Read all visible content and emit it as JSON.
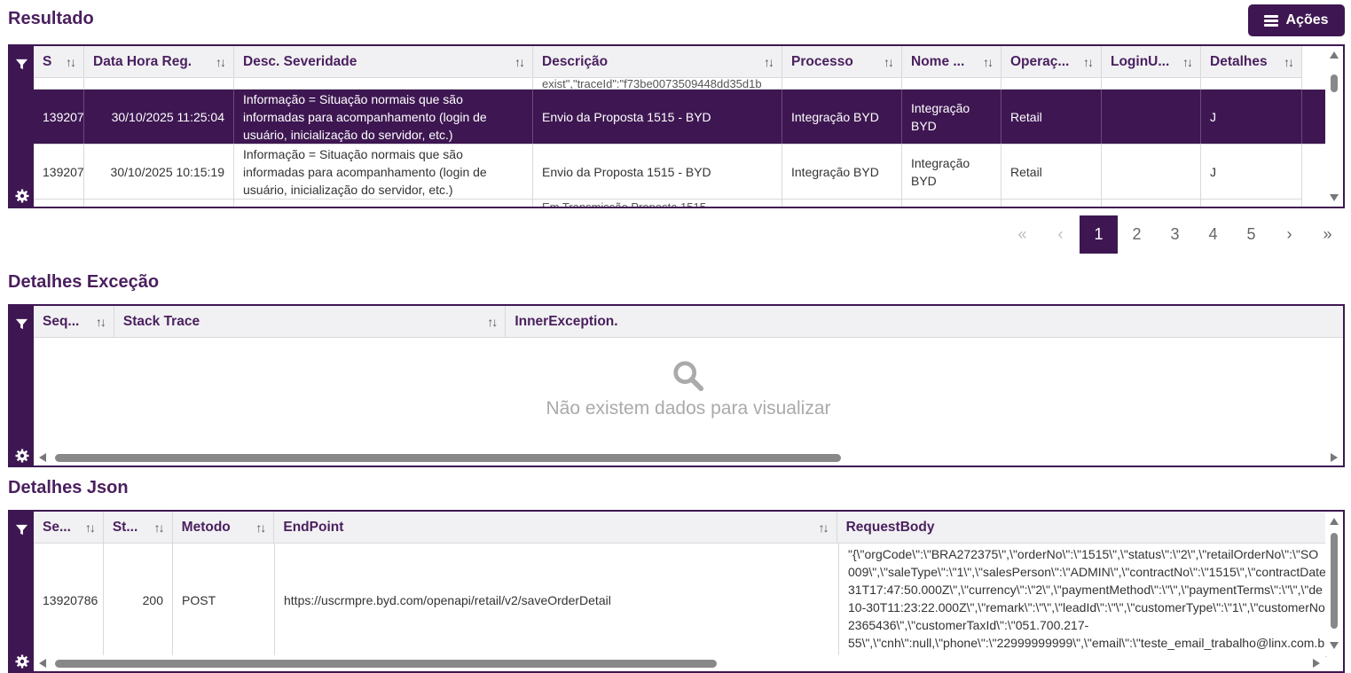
{
  "resultado": {
    "title": "Resultado",
    "acoes_label": "Ações",
    "headers": [
      "S",
      "Data Hora Reg.",
      "Desc. Severidade",
      "Descrição",
      "Processo",
      "Nome ...",
      "Operaç...",
      "LoginU...",
      "Detalhes"
    ],
    "partial_top_desc": "exist\",\"traceId\":\"f73be0073509448dd35d1b",
    "rows": [
      {
        "seq": "139207",
        "datetime": "30/10/2025 11:25:04",
        "severity": "Informação = Situação normais que são informadas para acompanhamento (login de usuário, inicialização do servidor, etc.)",
        "desc": "Envio da Proposta 1515 - BYD",
        "processo": "Integração BYD",
        "nome": "Integração BYD",
        "operacao": "Retail",
        "login": "",
        "detalhes": "J"
      },
      {
        "seq": "139207",
        "datetime": "30/10/2025 10:15:19",
        "severity": "Informação = Situação normais que são informadas para acompanhamento (login de usuário, inicialização do servidor, etc.)",
        "desc": "Envio da Proposta 1515 - BYD",
        "processo": "Integração BYD",
        "nome": "Integração BYD",
        "operacao": "Retail",
        "login": "",
        "detalhes": "J"
      }
    ],
    "partial_bottom_desc": "Em Transmissão Proposta 1515"
  },
  "pagination": {
    "first": "«",
    "prev": "‹",
    "pages": [
      "1",
      "2",
      "3",
      "4",
      "5"
    ],
    "active": "1",
    "next": "›",
    "last": "»"
  },
  "excecao": {
    "title": "Detalhes Exceção",
    "headers": [
      "Seq...",
      "Stack Trace",
      "InnerException."
    ],
    "empty_message": "Não existem dados para visualizar"
  },
  "json": {
    "title": "Detalhes Json",
    "headers": [
      "Se...",
      "St...",
      "Metodo",
      "EndPoint",
      "RequestBody"
    ],
    "row": {
      "seq": "13920786",
      "status": "200",
      "method": "POST",
      "endpoint": "https://uscrmpre.byd.com/openapi/retail/v2/saveOrderDetail",
      "body_lines": [
        "\"{\\\"orgCode\\\":\\\"BRA272375\\\",\\\"orderNo\\\":\\\"1515\\\",\\\"status\\\":\\\"2\\\",\\\"retailOrderNo\\\":\\\"SO",
        "009\\\",\\\"saleType\\\":\\\"1\\\",\\\"salesPerson\\\":\\\"ADMIN\\\",\\\"contractNo\\\":\\\"1515\\\",\\\"contractDate",
        "31T17:47:50.000Z\\\",\\\"currency\\\":\\\"2\\\",\\\"paymentMethod\\\":\\\"\\\",\\\"paymentTerms\\\":\\\"\\\",\\\"de",
        "10-30T11:23:22.000Z\\\",\\\"remark\\\":\\\"\\\",\\\"leadId\\\":\\\"\\\",\\\"customerType\\\":\\\"1\\\",\\\"customerNo",
        "2365436\\\",\\\"customerTaxId\\\":\\\"051.700.217-",
        "55\\\",\\\"cnh\\\":null,\\\"phone\\\":\\\"22999999999\\\",\\\"email\\\":\\\"teste_email_trabalho@linx.com.b"
      ]
    }
  },
  "colors": {
    "primary": "#3e1752",
    "title": "#4a1f5e"
  }
}
